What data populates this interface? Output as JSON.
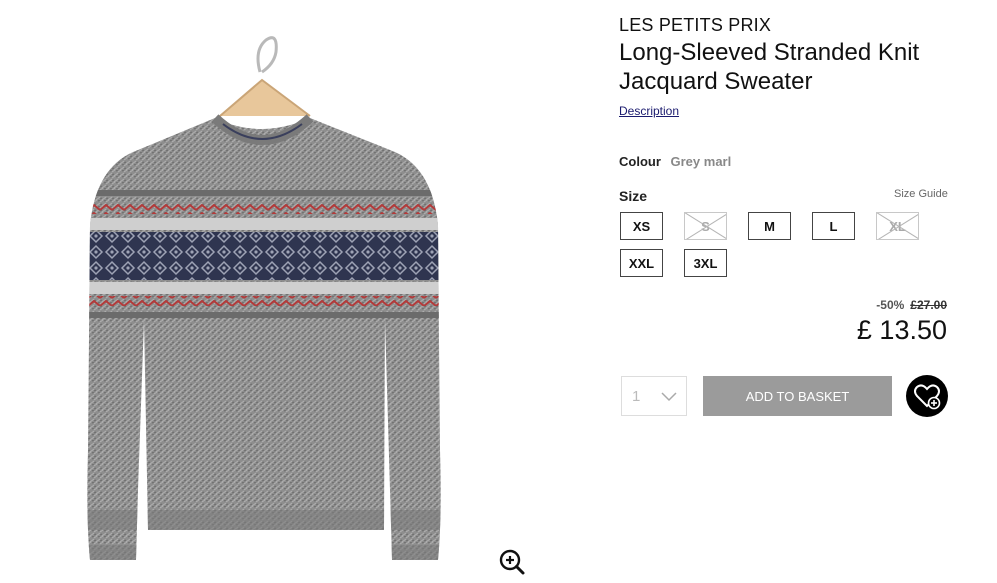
{
  "product": {
    "brand": "LES PETITS PRIX",
    "title": "Long-Sleeved Stranded Knit Jacquard Sweater",
    "description_link": "Description"
  },
  "colour": {
    "label": "Colour",
    "value": "Grey marl"
  },
  "size": {
    "label": "Size",
    "guide_label": "Size Guide",
    "options": [
      {
        "label": "XS",
        "available": true
      },
      {
        "label": "S",
        "available": false
      },
      {
        "label": "M",
        "available": true
      },
      {
        "label": "L",
        "available": true
      },
      {
        "label": "XL",
        "available": false
      },
      {
        "label": "XXL",
        "available": true
      },
      {
        "label": "3XL",
        "available": true
      }
    ]
  },
  "pricing": {
    "discount": "-50%",
    "original": "£27.00",
    "price": "£ 13.50"
  },
  "purchase": {
    "quantity": "1",
    "add_label": "ADD TO BASKET"
  },
  "icons": {
    "zoom": "zoom-in-icon",
    "quantity_dropdown": "chevron-down-icon",
    "wishlist": "heart-plus-icon"
  },
  "colors": {
    "add_button": "#9b9b9b",
    "wishlist_bg": "#000000",
    "link": "#1a1a6e"
  }
}
